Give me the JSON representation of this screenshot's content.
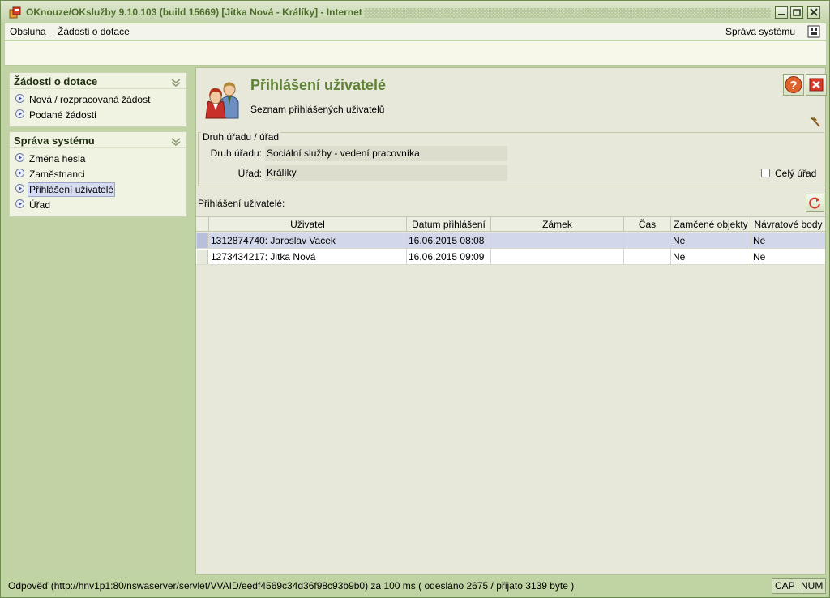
{
  "window": {
    "title": "OKnouze/OKslužby 9.10.103 (build 15669)  [Jitka Nová - Králíky] - Internet"
  },
  "menu": {
    "items": [
      "Obsluha",
      "Žádosti o dotace"
    ],
    "right_item": "Správa systému"
  },
  "sidebar": {
    "panels": [
      {
        "title": "Žádosti o dotace",
        "items": [
          "Nová / rozpracovaná žádost",
          "Podané žádosti"
        ]
      },
      {
        "title": "Správa systému",
        "items": [
          "Změna hesla",
          "Zaměstnanci",
          "Přihlášení uživatelé",
          "Úřad"
        ],
        "selected_index": 2
      }
    ]
  },
  "page": {
    "title": "Přihlášení uživatelé",
    "subtitle": "Seznam přihlášených uživatelů",
    "icons": {
      "header": "users-icon",
      "help": "help-icon",
      "close": "close-icon",
      "tool": "hammer-icon",
      "refresh": "refresh-icon"
    }
  },
  "filter": {
    "legend": "Druh úřadu / úřad",
    "druh_label": "Druh úřadu:",
    "druh_value": "Sociální služby - vedení pracovníka",
    "urad_label": "Úřad:",
    "urad_value": "Králíky",
    "cely_urad_label": "Celý úřad",
    "cely_urad_checked": false
  },
  "table": {
    "label": "Přihlášení uživatelé:",
    "columns": [
      "Uživatel",
      "Datum přihlášení",
      "Zámek",
      "Čas",
      "Zamčené objekty",
      "Návratové body"
    ],
    "rows": [
      [
        "1312874740: Jaroslav Vacek",
        "16.06.2015 08:08",
        "",
        "",
        "Ne",
        "Ne"
      ],
      [
        "1273434217: Jitka Nová",
        "16.06.2015 09:09",
        "",
        "",
        "Ne",
        "Ne"
      ]
    ],
    "selected_row": 0
  },
  "status": {
    "text": "Odpověď (http://hnv1p1:80/nswaserver/servlet/VVAID/eedf4569c34d36f98c93b9b0) za 100 ms ( odesláno 2675 / přijato 3139 byte )",
    "cap": "CAP",
    "num": "NUM"
  },
  "colors": {
    "accent": "#5e8236",
    "frame": "#c0d3a3",
    "selected_row": "#d2d7ea"
  }
}
